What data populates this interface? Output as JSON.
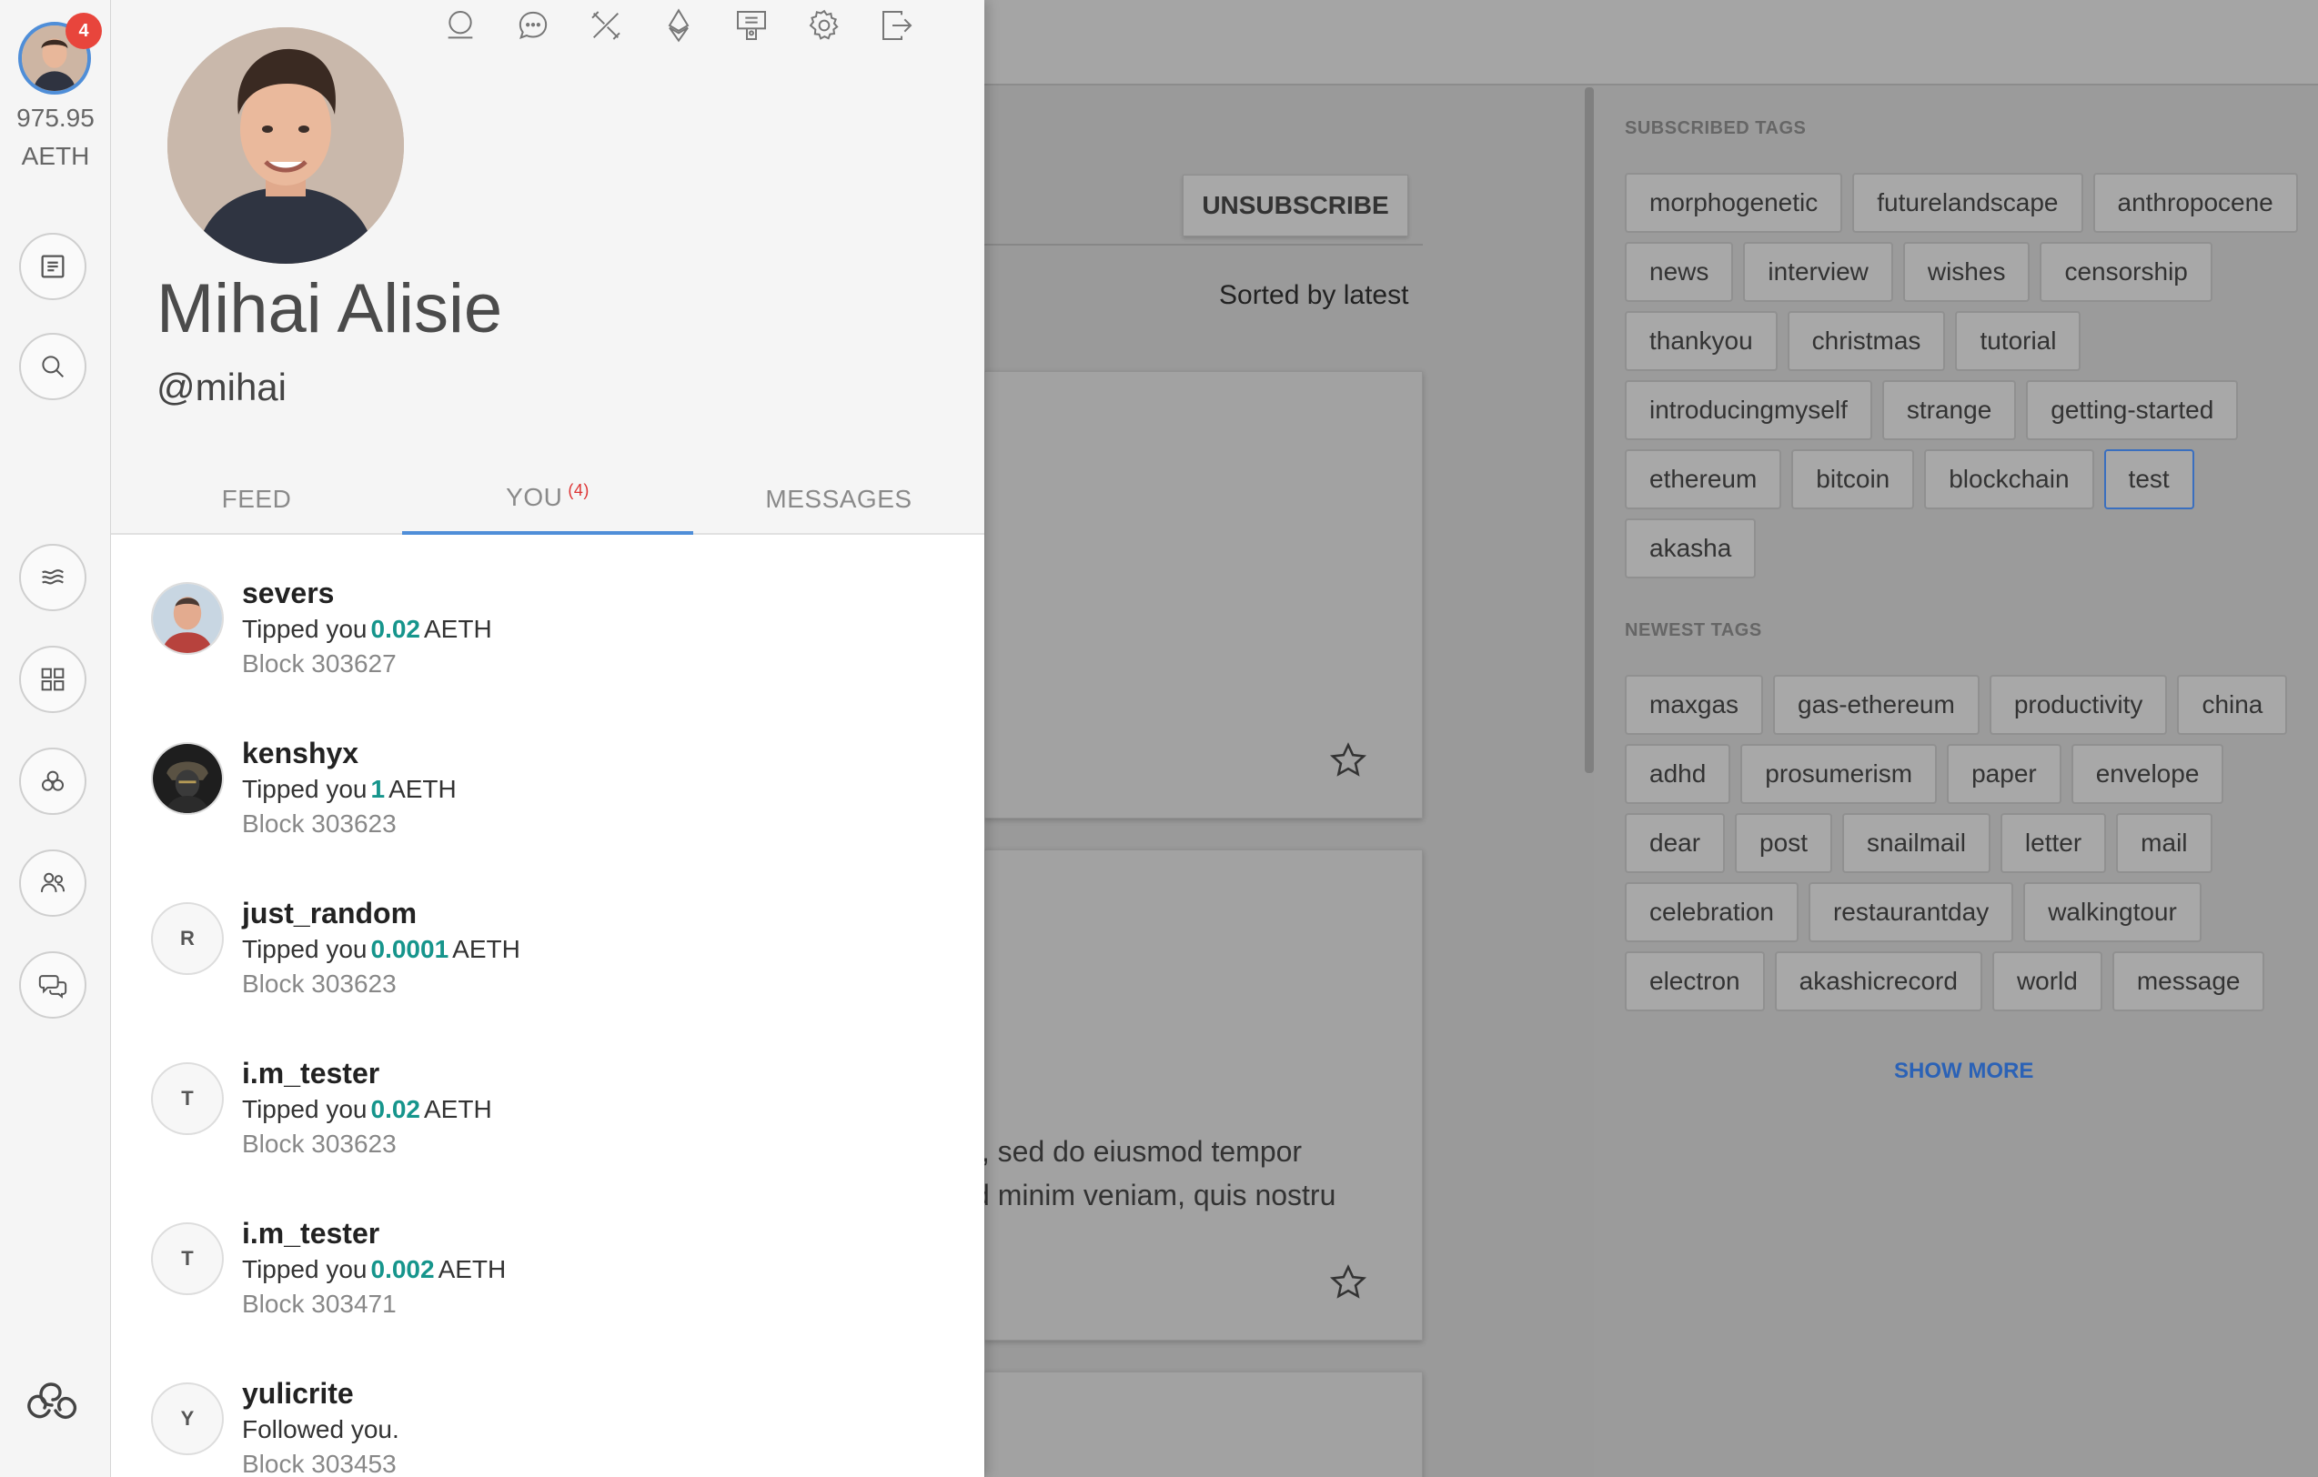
{
  "rail": {
    "badge_count": "4",
    "balance_amount": "975.95",
    "balance_unit": "AETH",
    "buttons": [
      "new-entry",
      "search",
      "streams",
      "apps",
      "highlights",
      "people",
      "chat"
    ]
  },
  "profile": {
    "name": "Mihai Alisie",
    "handle": "@mihai",
    "toolbar": [
      "profile",
      "comments",
      "tools",
      "ethereum",
      "wallet",
      "settings",
      "logout"
    ]
  },
  "tabs": [
    {
      "label": "FEED"
    },
    {
      "label": "YOU",
      "count": "(4)",
      "active": true
    },
    {
      "label": "MESSAGES"
    }
  ],
  "notifications": [
    {
      "user": "severs",
      "action": "Tipped you",
      "amount": "0.02",
      "unit": "AETH",
      "block": "Block 303627",
      "avatar": "photo"
    },
    {
      "user": "kenshyx",
      "action": "Tipped you",
      "amount": "1",
      "unit": "AETH",
      "block": "Block 303623",
      "avatar": "photo-dark"
    },
    {
      "user": "just_random",
      "action": "Tipped you",
      "amount": "0.0001",
      "unit": "AETH",
      "block": "Block 303623",
      "avatar": "R"
    },
    {
      "user": "i.m_tester",
      "action": "Tipped you",
      "amount": "0.02",
      "unit": "AETH",
      "block": "Block 303623",
      "avatar": "T"
    },
    {
      "user": "i.m_tester",
      "action": "Tipped you",
      "amount": "0.002",
      "unit": "AETH",
      "block": "Block 303471",
      "avatar": "T"
    },
    {
      "user": "yulicrite",
      "action": "Followed you.",
      "amount": "",
      "unit": "",
      "block": "Block 303453",
      "avatar": "Y"
    }
  ],
  "background": {
    "unsubscribe_label": "UNSUBSCRIBE",
    "sorted_label": "Sorted by latest",
    "card_text_line1": "t, sed do eiusmod tempor",
    "card_text_line2": "d minim veniam, quis nostru"
  },
  "subscribed_tags_title": "SUBSCRIBED TAGS",
  "subscribed_tags": [
    "morphogenetic",
    "futurelandscape",
    "anthropocene",
    "news",
    "interview",
    "wishes",
    "censorship",
    "thankyou",
    "christmas",
    "tutorial",
    "introducingmyself",
    "strange",
    "getting-started",
    "ethereum",
    "bitcoin",
    "blockchain",
    "test",
    "akasha"
  ],
  "selected_tag": "test",
  "newest_tags_title": "NEWEST TAGS",
  "newest_tags": [
    "maxgas",
    "gas-ethereum",
    "productivity",
    "china",
    "adhd",
    "prosumerism",
    "paper",
    "envelope",
    "dear",
    "post",
    "snailmail",
    "letter",
    "mail",
    "celebration",
    "restaurantday",
    "walkingtour",
    "electron",
    "akashicrecord",
    "world",
    "message"
  ],
  "show_more_label": "SHOW MORE",
  "colors": {
    "accent": "#4f8ed8",
    "amount": "#16958c",
    "badge": "#e8453c",
    "link": "#2b62b6"
  }
}
